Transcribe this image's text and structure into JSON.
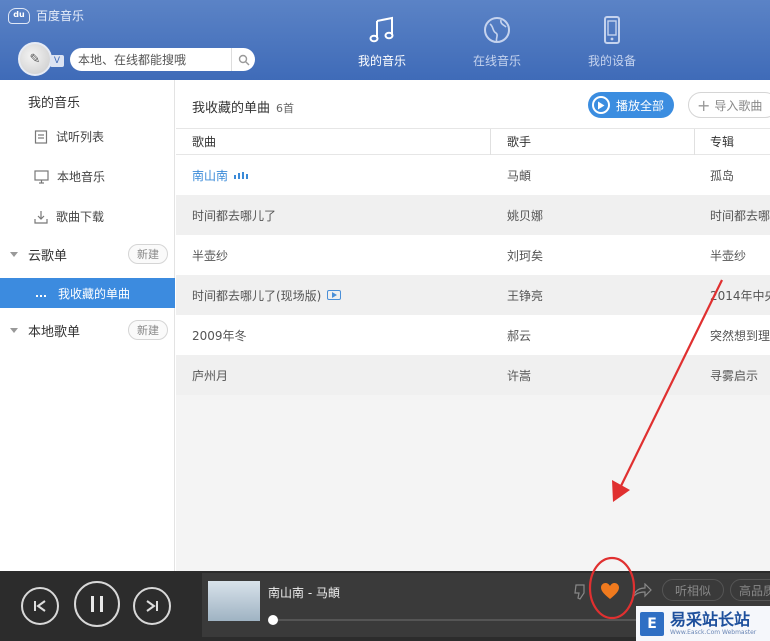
{
  "app": {
    "brand": "百度音乐",
    "brand_logo": "du"
  },
  "header": {
    "search_placeholder": "本地、在线都能搜哦",
    "tabs": [
      {
        "label": "我的音乐",
        "icon": "music-note-icon",
        "active": true
      },
      {
        "label": "在线音乐",
        "icon": "globe-icon",
        "active": false
      },
      {
        "label": "我的设备",
        "icon": "device-icon",
        "active": false
      }
    ]
  },
  "sidebar": {
    "title": "我的音乐",
    "items": [
      {
        "label": "试听列表",
        "icon": "list-icon"
      },
      {
        "label": "本地音乐",
        "icon": "monitor-icon"
      },
      {
        "label": "歌曲下载",
        "icon": "download-icon"
      }
    ],
    "groups": [
      {
        "label": "云歌单",
        "new_label": "新建"
      },
      {
        "label": "本地歌单",
        "new_label": "新建"
      }
    ],
    "active_item": {
      "label": "我收藏的单曲"
    }
  },
  "main": {
    "title": "我收藏的单曲",
    "count": "6首",
    "play_all_label": "播放全部",
    "import_label": "导入歌曲",
    "columns": [
      "歌曲",
      "歌手",
      "专辑"
    ],
    "rows": [
      {
        "song": "南山南",
        "artist": "马頔",
        "album": "孤岛",
        "playing": true
      },
      {
        "song": "时间都去哪儿了",
        "artist": "姚贝娜",
        "album": "时间都去哪"
      },
      {
        "song": "半壶纱",
        "artist": "刘珂矣",
        "album": "半壶纱"
      },
      {
        "song": "时间都去哪儿了(现场版)",
        "artist": "王铮亮",
        "album": "2014年中央",
        "mv": true
      },
      {
        "song": "2009年冬",
        "artist": "郝云",
        "album": "突然想到理"
      },
      {
        "song": "庐州月",
        "artist": "许嵩",
        "album": "寻雾启示"
      }
    ]
  },
  "player": {
    "now_playing": "南山南 - 马頔",
    "similar_label": "听相似",
    "quality_label": "高品质",
    "progress": 0.0,
    "heart_color": "#f07a1e"
  },
  "watermark": {
    "text": "易采站长站",
    "sub": "Www.Easck.Com Webmaster"
  },
  "colors": {
    "header": "#4a76bf",
    "accent": "#3c8bdf",
    "annotation": "#e03030"
  }
}
